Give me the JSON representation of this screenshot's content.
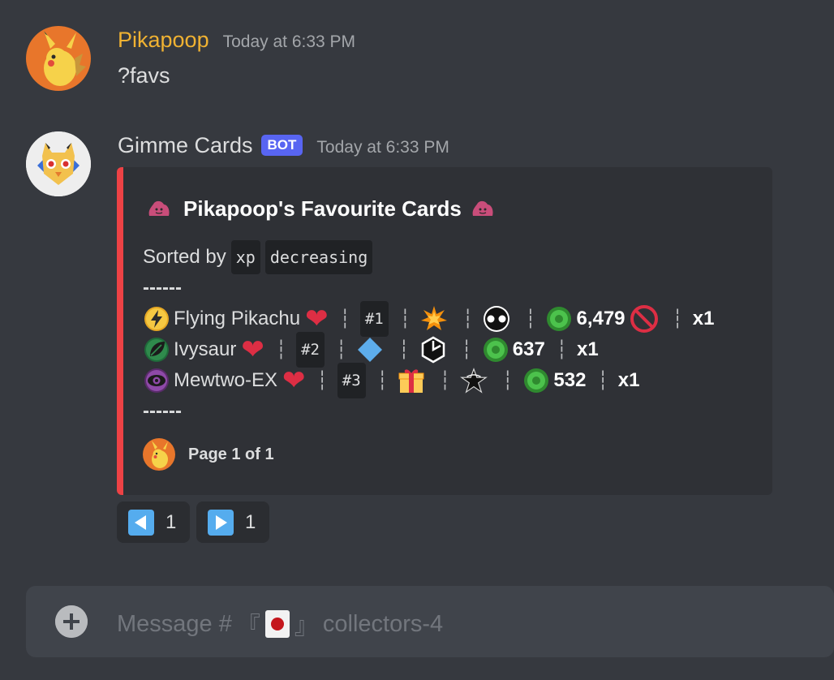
{
  "messages": [
    {
      "author": "Pikapoop",
      "author_color": "#f0b232",
      "timestamp": "Today at 6:33 PM",
      "content": "?favs",
      "avatar_icon": "pikachu-avatar-icon"
    },
    {
      "author": "Gimme Cards",
      "author_color": "#dcddde",
      "bot_tag": "BOT",
      "timestamp": "Today at 6:33 PM",
      "avatar_icon": "gimme-cards-bot-avatar-icon"
    }
  ],
  "embed": {
    "accent_color": "#ed4245",
    "title": "Pikapoop's Favourite Cards",
    "sorted_label": "Sorted by",
    "sort_field": "xp",
    "sort_order": "decreasing",
    "divider_top": "------",
    "divider_bottom": "------",
    "cards": [
      {
        "type_icon": "lightning-type-icon",
        "name": "Flying Pikachu",
        "rank": "#1",
        "rarity_icon": "star-burst-rarity-icon",
        "set_icon": "black-circle-set-icon",
        "xp": "6,479",
        "extra_icon": "no-entry-icon",
        "count": "x1"
      },
      {
        "type_icon": "grass-type-icon",
        "name": "Ivysaur",
        "rank": "#2",
        "rarity_icon": "blue-diamond-rarity-icon",
        "set_icon": "hexagon-set-icon",
        "xp": "637",
        "count": "x1"
      },
      {
        "type_icon": "psychic-type-icon",
        "name": "Mewtwo-EX",
        "rank": "#3",
        "rarity_icon": "gift-rarity-icon",
        "set_icon": "promo-star-set-icon",
        "xp": "532",
        "count": "x1"
      }
    ],
    "footer": "Page 1 of 1"
  },
  "buttons": [
    {
      "icon": "arrow-left-icon",
      "label": "1"
    },
    {
      "icon": "arrow-right-icon",
      "label": "1"
    }
  ],
  "composer": {
    "placeholder_prefix": "Message #",
    "channel_open": "『",
    "channel_icon": "flower-card-icon",
    "channel_close": "』",
    "channel_name": "collectors-4"
  }
}
